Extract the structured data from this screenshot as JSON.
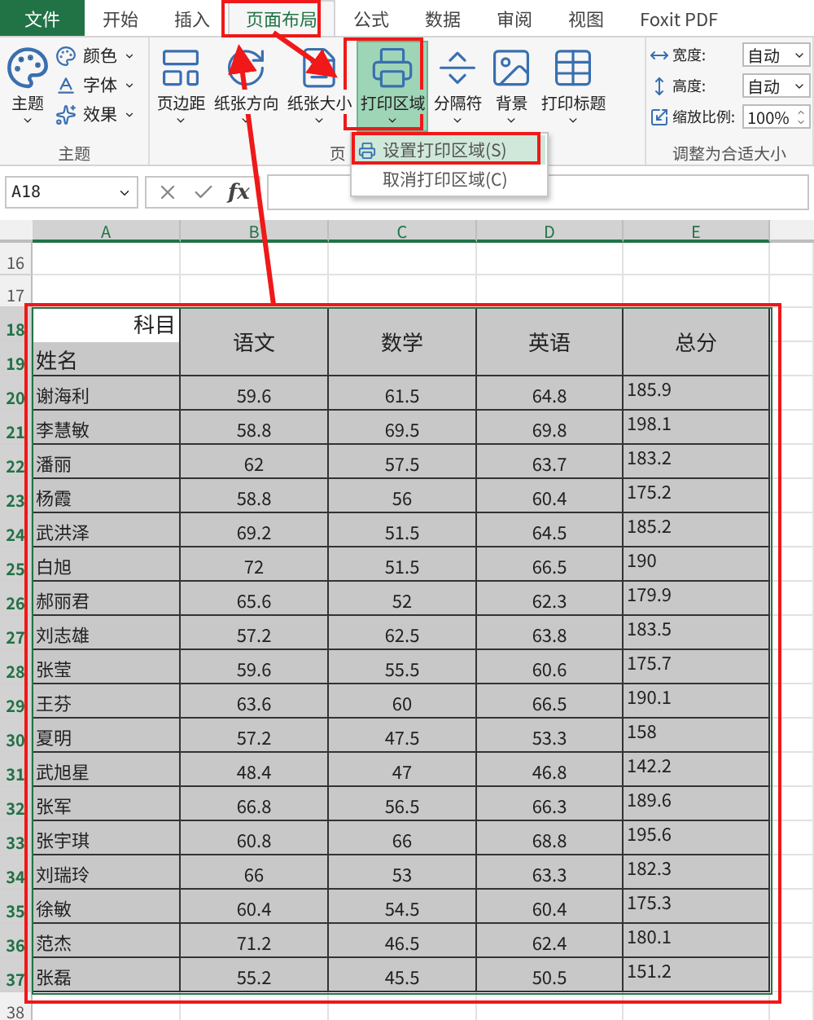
{
  "tabs": [
    {
      "label": "文件",
      "kind": "file",
      "selected": false
    },
    {
      "label": "开始",
      "kind": "tab",
      "selected": false
    },
    {
      "label": "插入",
      "kind": "tab",
      "selected": false
    },
    {
      "label": "页面布局",
      "kind": "tab",
      "selected": true
    },
    {
      "label": "公式",
      "kind": "tab",
      "selected": false
    },
    {
      "label": "数据",
      "kind": "tab",
      "selected": false
    },
    {
      "label": "审阅",
      "kind": "tab",
      "selected": false
    },
    {
      "label": "视图",
      "kind": "tab",
      "selected": false
    },
    {
      "label": "Foxit PDF",
      "kind": "tab",
      "selected": false
    }
  ],
  "ribbon": {
    "theme_group": {
      "label": "主题",
      "large_button": "主题",
      "small_buttons": [
        "颜色",
        "字体",
        "效果"
      ]
    },
    "page_setup_group": {
      "label": "页",
      "buttons": [
        {
          "label": "页边距",
          "pressed": false
        },
        {
          "label": "纸张方向",
          "pressed": false
        },
        {
          "label": "纸张大小",
          "pressed": false
        },
        {
          "label": "打印区域",
          "pressed": true
        },
        {
          "label": "分隔符",
          "pressed": false
        },
        {
          "label": "背景",
          "pressed": false
        },
        {
          "label": "打印标题",
          "pressed": false
        }
      ]
    },
    "scale_group": {
      "label": "调整为合适大小",
      "fields": [
        {
          "label": "宽度:",
          "value": "自动",
          "kind": "select"
        },
        {
          "label": "高度:",
          "value": "自动",
          "kind": "select"
        },
        {
          "label": "缩放比例:",
          "value": "100%",
          "kind": "spin"
        }
      ]
    }
  },
  "dropdown": {
    "items": [
      {
        "label": "设置打印区域(S)",
        "selected": true
      },
      {
        "label": "取消打印区域(C)",
        "selected": false
      }
    ]
  },
  "formula_bar": {
    "name_box": "A18",
    "function_label": "fx"
  },
  "sheet": {
    "columns": [
      {
        "label": "A",
        "selected": true
      },
      {
        "label": "B",
        "selected": true
      },
      {
        "label": "C",
        "selected": true
      },
      {
        "label": "D",
        "selected": true
      },
      {
        "label": "E",
        "selected": true
      }
    ],
    "rows_before": [
      {
        "row": "16",
        "selected": false
      },
      {
        "row": "17",
        "selected": false
      }
    ],
    "header_rows": [
      {
        "row": "18",
        "selected": true
      },
      {
        "row": "19",
        "selected": true
      }
    ],
    "corner_top": "科目",
    "corner_bottom": "姓名",
    "headers": [
      "语文",
      "数学",
      "英语",
      "总分"
    ],
    "rows": [
      {
        "row": "20",
        "selected": true,
        "cells": [
          "谢海利",
          "59.6",
          "61.5",
          "64.8",
          "185.9"
        ]
      },
      {
        "row": "21",
        "selected": true,
        "cells": [
          "李慧敏",
          "58.8",
          "69.5",
          "69.8",
          "198.1"
        ]
      },
      {
        "row": "22",
        "selected": true,
        "cells": [
          "潘丽",
          "62",
          "57.5",
          "63.7",
          "183.2"
        ]
      },
      {
        "row": "23",
        "selected": true,
        "cells": [
          "杨霞",
          "58.8",
          "56",
          "60.4",
          "175.2"
        ]
      },
      {
        "row": "24",
        "selected": true,
        "cells": [
          "武洪泽",
          "69.2",
          "51.5",
          "64.5",
          "185.2"
        ]
      },
      {
        "row": "25",
        "selected": true,
        "cells": [
          "白旭",
          "72",
          "51.5",
          "66.5",
          "190"
        ]
      },
      {
        "row": "26",
        "selected": true,
        "cells": [
          "郝丽君",
          "65.6",
          "52",
          "62.3",
          "179.9"
        ]
      },
      {
        "row": "27",
        "selected": true,
        "cells": [
          "刘志雄",
          "57.2",
          "62.5",
          "63.8",
          "183.5"
        ]
      },
      {
        "row": "28",
        "selected": true,
        "cells": [
          "张莹",
          "59.6",
          "55.5",
          "60.6",
          "175.7"
        ]
      },
      {
        "row": "29",
        "selected": true,
        "cells": [
          "王芬",
          "63.6",
          "60",
          "66.5",
          "190.1"
        ]
      },
      {
        "row": "30",
        "selected": true,
        "cells": [
          "夏明",
          "57.2",
          "47.5",
          "53.3",
          "158"
        ]
      },
      {
        "row": "31",
        "selected": true,
        "cells": [
          "武旭星",
          "48.4",
          "47",
          "46.8",
          "142.2"
        ]
      },
      {
        "row": "32",
        "selected": true,
        "cells": [
          "张军",
          "66.8",
          "56.5",
          "66.3",
          "189.6"
        ]
      },
      {
        "row": "33",
        "selected": true,
        "cells": [
          "张宇琪",
          "60.8",
          "66",
          "68.8",
          "195.6"
        ]
      },
      {
        "row": "34",
        "selected": true,
        "cells": [
          "刘瑞玲",
          "66",
          "53",
          "63.3",
          "182.3"
        ]
      },
      {
        "row": "35",
        "selected": true,
        "cells": [
          "徐敏",
          "60.4",
          "54.5",
          "60.4",
          "175.3"
        ]
      },
      {
        "row": "36",
        "selected": true,
        "cells": [
          "范杰",
          "71.2",
          "46.5",
          "62.4",
          "180.1"
        ]
      },
      {
        "row": "37",
        "selected": true,
        "cells": [
          "张磊",
          "55.2",
          "45.5",
          "50.5",
          "151.2"
        ]
      }
    ],
    "rows_after": [
      {
        "row": "38",
        "selected": false
      }
    ]
  }
}
